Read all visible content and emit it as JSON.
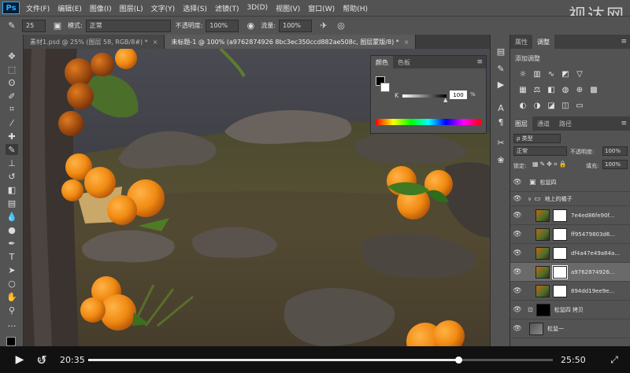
{
  "app": {
    "logo": "Ps",
    "watermark": "视达网",
    "menu": [
      "文件(F)",
      "编辑(E)",
      "图像(I)",
      "图层(L)",
      "文字(Y)",
      "选择(S)",
      "滤镜(T)",
      "3D(D)",
      "视图(V)",
      "窗口(W)",
      "帮助(H)"
    ]
  },
  "options": {
    "brush_size": "25",
    "mode_label": "模式:",
    "mode_value": "正常",
    "opacity_label": "不透明度:",
    "opacity_value": "100%",
    "flow_label": "流量:",
    "flow_value": "100%"
  },
  "doc_tabs": [
    {
      "label": "素材1.psd @ 25% (图层 58, RGB/8#) *",
      "close": "×"
    },
    {
      "label": "未标题-1 @ 100% (a9762874926 8bc3ec350ccd882ae508c, 图层蒙版/8) *",
      "close": "×"
    }
  ],
  "color_panel": {
    "tabs": [
      "颜色",
      "色板"
    ],
    "channel": "K",
    "value": "100",
    "unit": "%"
  },
  "properties_panel": {
    "tabs": [
      "属性",
      "调整"
    ],
    "title": "添加调整"
  },
  "layers_panel": {
    "tabs": [
      "图层",
      "通道",
      "路径"
    ],
    "filter_label": "ρ 类型",
    "blend_mode": "正常",
    "opacity_label": "不透明度:",
    "opacity_value": "100%",
    "lock_label": "锁定:",
    "fill_label": "填充:",
    "fill_value": "100%",
    "layers": [
      {
        "name": "松鼠四",
        "type": "group"
      },
      {
        "name": "地上的橘子",
        "type": "group"
      },
      {
        "name": "7e4ed86fe90f...",
        "type": "layer"
      },
      {
        "name": "ff95479803d6...",
        "type": "layer"
      },
      {
        "name": "df4a47e49a84a...",
        "type": "layer"
      },
      {
        "name": "a9762874926...",
        "type": "layer",
        "selected": true
      },
      {
        "name": "894dd19ee9e...",
        "type": "layer"
      },
      {
        "name": "松鼠四 拷贝",
        "type": "layer",
        "mask": "black"
      },
      {
        "name": "松鼠一",
        "type": "layer"
      }
    ]
  },
  "video": {
    "current_time": "20:35",
    "total_time": "25:50",
    "progress": 0.797,
    "replay_label": "15"
  },
  "colors": {
    "ui_gray": "#535353",
    "accent_blue": "#31a8ff"
  }
}
